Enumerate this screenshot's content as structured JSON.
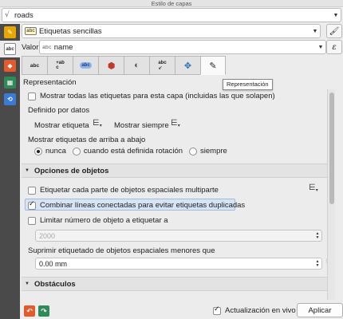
{
  "window": {
    "title": "Estilo de capas"
  },
  "layer_selector": {
    "value": "roads",
    "icon": "line-layer-icon"
  },
  "sidebar": {
    "items": [
      {
        "icon": "symbology-icon",
        "color": "#e6a800"
      },
      {
        "icon": "labels-icon",
        "color": "#f5f5f5",
        "text": "abc"
      },
      {
        "icon": "3d-view-icon",
        "color": "#e55a2b"
      },
      {
        "icon": "diagrams-icon",
        "color": "#2e8b57"
      },
      {
        "icon": "rendering-icon",
        "color": "#3a7bd5"
      }
    ]
  },
  "label_mode": {
    "value": "Etiquetas sencillas"
  },
  "value_field": {
    "label": "Valor",
    "type_badge": "abc",
    "value": "name"
  },
  "tabs": [
    {
      "name": "text-tab",
      "glyph": "abc"
    },
    {
      "name": "formatting-tab",
      "glyph": "+ab c"
    },
    {
      "name": "buffer-tab",
      "glyph": "abc"
    },
    {
      "name": "background-tab",
      "glyph": "■"
    },
    {
      "name": "shadow-tab",
      "glyph": "◐"
    },
    {
      "name": "placement-tab",
      "glyph": "abc"
    },
    {
      "name": "placement-grid-tab",
      "glyph": "✥"
    },
    {
      "name": "rendering-tab",
      "glyph": "✎"
    }
  ],
  "tooltip": "Representación",
  "section_title": "Representación",
  "options": {
    "show_all_labels": {
      "label": "Mostrar todas las etiquetas para esta capa (incluidas las que solapen)",
      "checked": false
    },
    "data_defined_label": "Definido por datos",
    "show_label": "Mostrar etiqueta",
    "always_show": "Mostrar siempre",
    "upside_down_label": "Mostrar etiquetas de arriba a abajo",
    "upside_down_choices": [
      {
        "label": "nunca",
        "selected": true
      },
      {
        "label": "cuando está definida rotación",
        "selected": false
      },
      {
        "label": "siempre",
        "selected": false
      }
    ]
  },
  "feature_options": {
    "title": "Opciones de objetos",
    "label_every_part": {
      "label": "Etiquetar cada parte de objetos espaciales multiparte",
      "checked": false
    },
    "merge_lines": {
      "label": "Combinar líneas conectadas para evitar etiquetas duplicadas",
      "checked": true
    },
    "limit_features": {
      "label": "Limitar número de objeto a etiquetar a",
      "checked": false
    },
    "limit_value": "2000",
    "suppress_label": "Suprimir etiquetado de objetos espaciales menores que",
    "suppress_value": "0.00 mm"
  },
  "obstacles": {
    "title": "Obstáculos"
  },
  "footer": {
    "live_update": {
      "label": "Actualización en vivo",
      "checked": true
    },
    "apply_label": "Aplicar"
  }
}
